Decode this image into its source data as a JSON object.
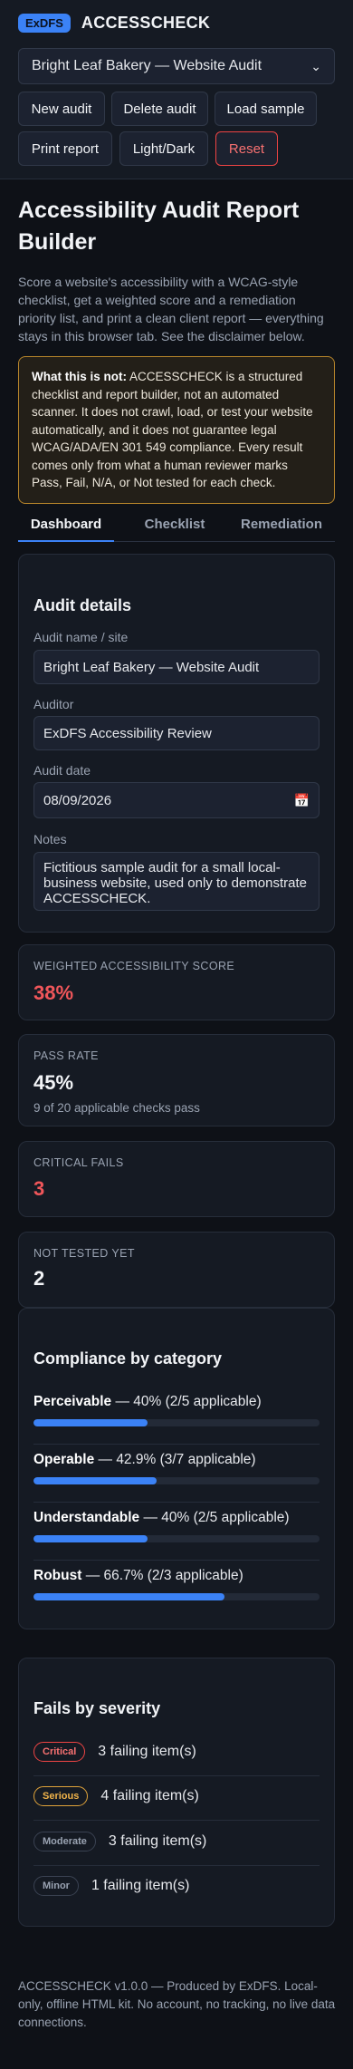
{
  "header": {
    "badge": "ExDFS",
    "title": "ACCESSCHECK"
  },
  "audit_select": {
    "value": "Bright Leaf Bakery — Website Audit"
  },
  "toolbar": {
    "new": "New audit",
    "delete": "Delete audit",
    "load": "Load sample",
    "print": "Print report",
    "theme": "Light/Dark",
    "reset": "Reset"
  },
  "page": {
    "title": "Accessibility Audit Report Builder",
    "intro": "Score a website's accessibility with a WCAG-style checklist, get a weighted score and a remediation priority list, and print a clean client report — everything stays in this browser tab. See the disclaimer below.",
    "disclaimer_lead": "What this is not:",
    "disclaimer_body": " ACCESSCHECK is a structured checklist and report builder, not an automated scanner. It does not crawl, load, or test your website automatically, and it does not guarantee legal WCAG/ADA/EN 301 549 compliance. Every result comes only from what a human reviewer marks Pass, Fail, N/A, or Not tested for each check."
  },
  "tabs": [
    {
      "label": "Dashboard",
      "active": true
    },
    {
      "label": "Checklist"
    },
    {
      "label": "Remediation"
    }
  ],
  "audit_details": {
    "title": "Audit details",
    "name_label": "Audit name / site",
    "name_value": "Bright Leaf Bakery — Website Audit",
    "auditor_label": "Auditor",
    "auditor_value": "ExDFS Accessibility Review",
    "date_label": "Audit date",
    "date_value": "08/09/2026",
    "notes_label": "Notes",
    "notes_value": "Fictitious sample audit for a small local-business website, used only to demonstrate ACCESSCHECK."
  },
  "stats": {
    "score_label": "WEIGHTED ACCESSIBILITY SCORE",
    "score_value": "38%",
    "pass_label": "PASS RATE",
    "pass_value": "45%",
    "pass_sub": "9 of 20 applicable checks pass",
    "critical_label": "CRITICAL FAILS",
    "critical_value": "3",
    "nottested_label": "NOT TESTED YET",
    "nottested_value": "2"
  },
  "compliance": {
    "title": "Compliance by category",
    "categories": [
      {
        "name": "Perceivable",
        "detail": " — 40% (2/5 applicable)",
        "pct": 40
      },
      {
        "name": "Operable",
        "detail": " — 42.9% (3/7 applicable)",
        "pct": 42.9
      },
      {
        "name": "Understandable",
        "detail": " — 40% (2/5 applicable)",
        "pct": 40
      },
      {
        "name": "Robust",
        "detail": " — 66.7% (2/3 applicable)",
        "pct": 66.7
      }
    ]
  },
  "severity": {
    "title": "Fails by severity",
    "rows": [
      {
        "label": "Critical",
        "text": "3 failing item(s)"
      },
      {
        "label": "Serious",
        "text": "4 failing item(s)"
      },
      {
        "label": "Moderate",
        "text": "3 failing item(s)"
      },
      {
        "label": "Minor",
        "text": "1 failing item(s)"
      }
    ]
  },
  "footer": {
    "text": "ACCESSCHECK v1.0.0 — Produced by ExDFS. Local-only, offline HTML kit. No account, no tracking, no live data connections."
  },
  "colors": {
    "accent": "#3b82f6",
    "danger": "#f0565a",
    "warning": "#e0a33a",
    "background": "#0e1117"
  }
}
